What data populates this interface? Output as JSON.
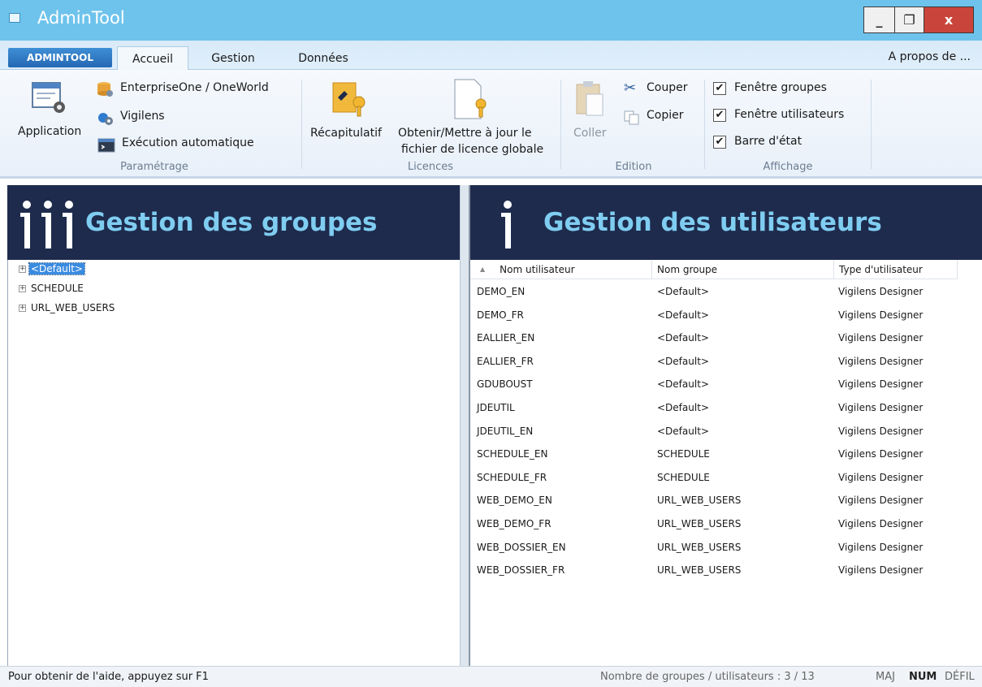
{
  "window": {
    "title": "AdminTool",
    "controls": {
      "minimize": "_",
      "maximize": "❐",
      "close": "x"
    }
  },
  "ribbon": {
    "app_tab": "ADMINTOOL",
    "tabs": [
      {
        "label": "Accueil",
        "active": true
      },
      {
        "label": "Gestion",
        "active": false
      },
      {
        "label": "Données",
        "active": false
      }
    ],
    "about": "A propos de ...",
    "groups": {
      "parametrage": {
        "label": "Paramétrage",
        "application": "Application",
        "enterprise": "EnterpriseOne / OneWorld",
        "vigilens": "Vigilens",
        "execution": "Exécution automatique"
      },
      "licences": {
        "label": "Licences",
        "recap": "Récapitulatif",
        "licence_line1": "Obtenir/Mettre à jour le",
        "licence_line2": "fichier de licence globale"
      },
      "edition": {
        "label": "Edition",
        "coller": "Coller",
        "couper": "Couper",
        "copier": "Copier"
      },
      "affichage": {
        "label": "Affichage",
        "options": [
          {
            "label": "Fenêtre groupes",
            "checked": true
          },
          {
            "label": "Fenêtre utilisateurs",
            "checked": true
          },
          {
            "label": "Barre d'état",
            "checked": true
          }
        ]
      }
    }
  },
  "groups_panel": {
    "title": "Gestion des groupes",
    "items": [
      {
        "label": "<Default>",
        "selected": true
      },
      {
        "label": "SCHEDULE",
        "selected": false
      },
      {
        "label": "URL_WEB_USERS",
        "selected": false
      }
    ]
  },
  "users_panel": {
    "title": "Gestion des utilisateurs",
    "columns": [
      "Nom utilisateur",
      "Nom groupe",
      "Type d'utilisateur"
    ],
    "sort_indicator": "▲",
    "rows": [
      [
        "DEMO_EN",
        "<Default>",
        "Vigilens Designer"
      ],
      [
        "DEMO_FR",
        "<Default>",
        "Vigilens Designer"
      ],
      [
        "EALLIER_EN",
        "<Default>",
        "Vigilens Designer"
      ],
      [
        "EALLIER_FR",
        "<Default>",
        "Vigilens Designer"
      ],
      [
        "GDUBOUST",
        "<Default>",
        "Vigilens Designer"
      ],
      [
        "JDEUTIL",
        "<Default>",
        "Vigilens Designer"
      ],
      [
        "JDEUTIL_EN",
        "<Default>",
        "Vigilens Designer"
      ],
      [
        "SCHEDULE_EN",
        "SCHEDULE",
        "Vigilens Designer"
      ],
      [
        "SCHEDULE_FR",
        "SCHEDULE",
        "Vigilens Designer"
      ],
      [
        "WEB_DEMO_EN",
        "URL_WEB_USERS",
        "Vigilens Designer"
      ],
      [
        "WEB_DEMO_FR",
        "URL_WEB_USERS",
        "Vigilens Designer"
      ],
      [
        "WEB_DOSSIER_EN",
        "URL_WEB_USERS",
        "Vigilens Designer"
      ],
      [
        "WEB_DOSSIER_FR",
        "URL_WEB_USERS",
        "Vigilens Designer"
      ]
    ]
  },
  "statusbar": {
    "help": "Pour obtenir de l'aide, appuyez sur F1",
    "count": "Nombre de groupes / utilisateurs : 3 / 13",
    "maj": "MAJ",
    "num": "NUM",
    "defil": "DÉFIL"
  },
  "colors": {
    "titlebar": "#6ec3ec",
    "panel_header": "#1e2b4d",
    "panel_title": "#7fcdf1",
    "selection": "#3a8be0"
  }
}
